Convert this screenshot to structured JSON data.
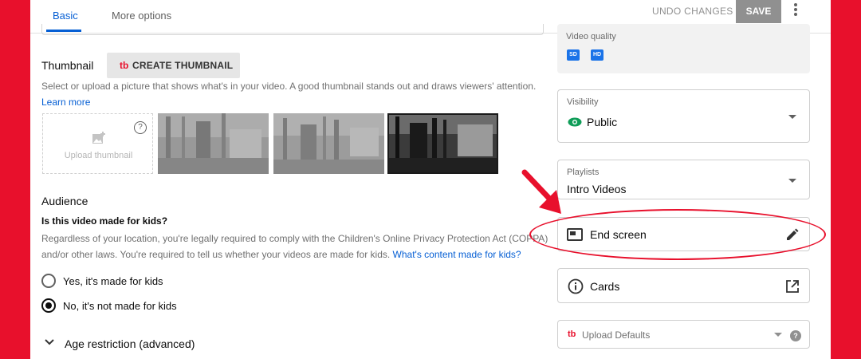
{
  "tabs": {
    "basic": "Basic",
    "more_options": "More options"
  },
  "header": {
    "undo_label": "UNDO CHANGES",
    "save_label": "SAVE"
  },
  "thumbnail": {
    "title": "Thumbnail",
    "create_button": "CREATE THUMBNAIL",
    "create_logo": "tb",
    "help": "Select or upload a picture that shows what's in your video. A good thumbnail stands out and draws viewers' attention.",
    "learn_more": "Learn more",
    "upload_label": "Upload thumbnail",
    "help_icon_glyph": "?"
  },
  "audience": {
    "title": "Audience",
    "question": "Is this video made for kids?",
    "help_1": "Regardless of your location, you're legally required to comply with the Children's Online Privacy Protection Act (COPPA)",
    "help_2": "and/or other laws. You're required to tell us whether your videos are made for kids.",
    "help_link": "What's content made for kids?",
    "options": [
      {
        "label": "Yes, it's made for kids",
        "checked": false
      },
      {
        "label": "No, it's not made for kids",
        "checked": true
      }
    ],
    "age_restriction": "Age restriction (advanced)"
  },
  "sidebar": {
    "video_quality": {
      "caption": "Video quality",
      "badges": [
        "SD",
        "HD"
      ]
    },
    "visibility": {
      "caption": "Visibility",
      "value": "Public"
    },
    "playlists": {
      "caption": "Playlists",
      "value": "Intro Videos"
    },
    "end_screen": {
      "label": "End screen"
    },
    "cards": {
      "label": "Cards"
    },
    "upload_defaults": {
      "logo": "tb",
      "label": "Upload Defaults",
      "help_glyph": "?"
    }
  },
  "colors": {
    "accent": "#065fd4",
    "brand_red": "#e8102c",
    "visibility_green": "#0f9d58",
    "quality_blue": "#1a73e8"
  }
}
